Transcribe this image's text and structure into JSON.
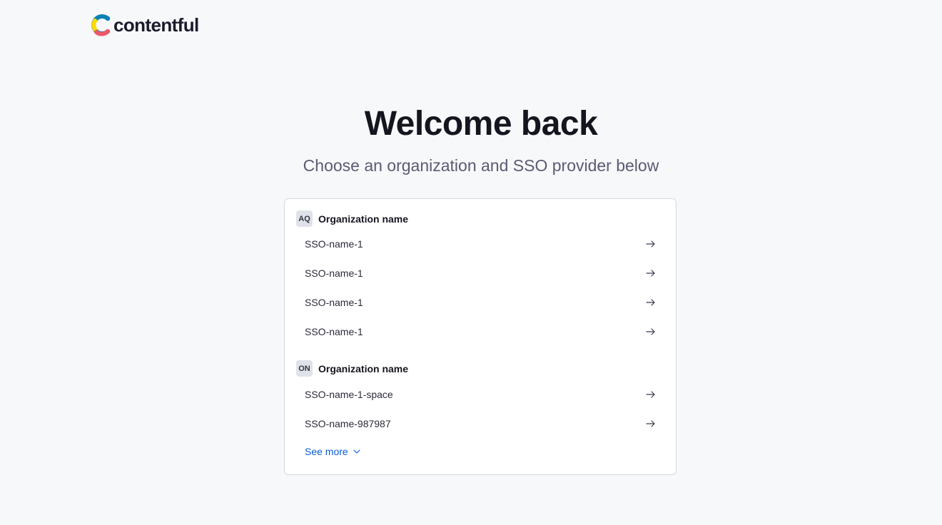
{
  "brand": {
    "name": "contentful",
    "logo_colors": {
      "yellow": "#ffda00",
      "blue": "#0681b6",
      "red": "#eb5a68",
      "dark": "#1b1b2b"
    }
  },
  "header": {
    "title": "Welcome back",
    "subtitle": "Choose an organization and SSO provider below"
  },
  "organizations": [
    {
      "initials": "AQ",
      "name": "Organization name",
      "providers": [
        {
          "label": "SSO-name-1",
          "icon": "arrow-right-icon"
        },
        {
          "label": "SSO-name-1",
          "icon": "arrow-right-icon"
        },
        {
          "label": "SSO-name-1",
          "icon": "arrow-right-icon"
        },
        {
          "label": "SSO-name-1",
          "icon": "arrow-right-icon"
        }
      ]
    },
    {
      "initials": "ON",
      "name": "Organization name",
      "providers": [
        {
          "label": "SSO-name-1-space",
          "icon": "arrow-right-icon"
        },
        {
          "label": "SSO-name-987987",
          "icon": "arrow-right-icon"
        }
      ]
    }
  ],
  "see_more": {
    "label": "See more",
    "icon": "chevron-down-icon",
    "color": "#0b5cd5"
  }
}
